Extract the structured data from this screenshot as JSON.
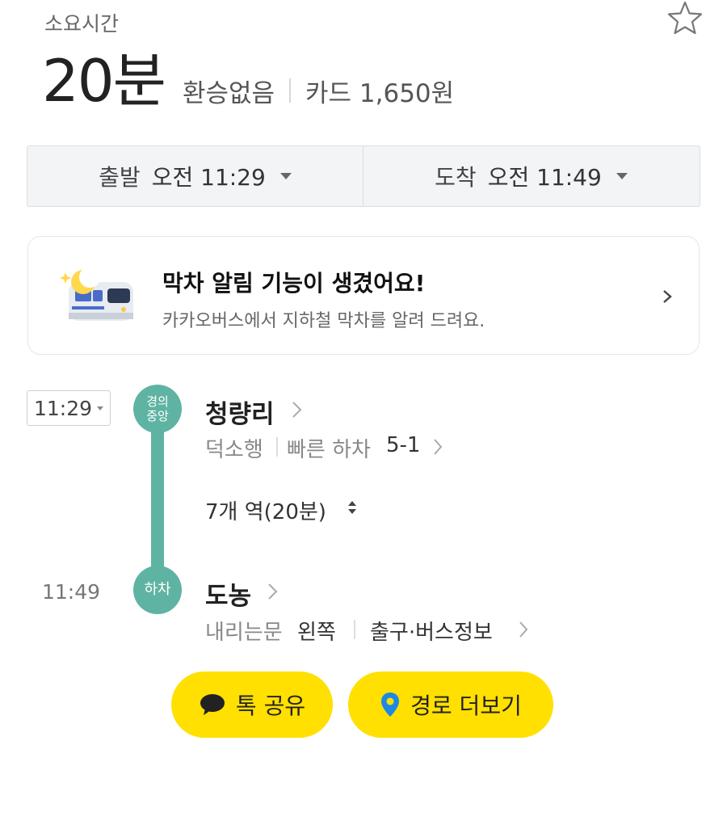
{
  "summary": {
    "duration_caption": "소요시간",
    "duration": "20분",
    "transfer": "환승없음",
    "fare": "카드 1,650원"
  },
  "time_selector": {
    "depart_label": "출발",
    "depart_time": "오전 11:29",
    "arrive_label": "도착",
    "arrive_time": "오전 11:49"
  },
  "banner": {
    "title": "막차 알림 기능이 생겼어요!",
    "subtitle": "카카오버스에서 지하철 막차를 알려 드려요."
  },
  "route": {
    "depart_time": "11:29",
    "line_badge_line1": "경의",
    "line_badge_line2": "중앙",
    "start_station": "청량리",
    "direction": "덕소행",
    "fast_exit_label": "빠른 하차",
    "fast_exit_value": "5-1",
    "stops_summary": "7개 역(20분)",
    "arrive_time": "11:49",
    "alight_badge": "하차",
    "end_station": "도농",
    "door_label": "내리는문",
    "door_value": "왼쪽",
    "exit_info": "출구·버스정보"
  },
  "actions": {
    "share_label": "톡 공유",
    "more_route_label": "경로 더보기"
  },
  "colors": {
    "line_color": "#5fb3a2",
    "button_yellow": "#ffe000",
    "pin_blue": "#1e88e5"
  },
  "icons": [
    "star-icon",
    "caret-down-icon",
    "moon-subway-icon",
    "chevron-right-icon",
    "updown-arrow-icon",
    "speech-bubble-icon",
    "location-pin-icon"
  ]
}
